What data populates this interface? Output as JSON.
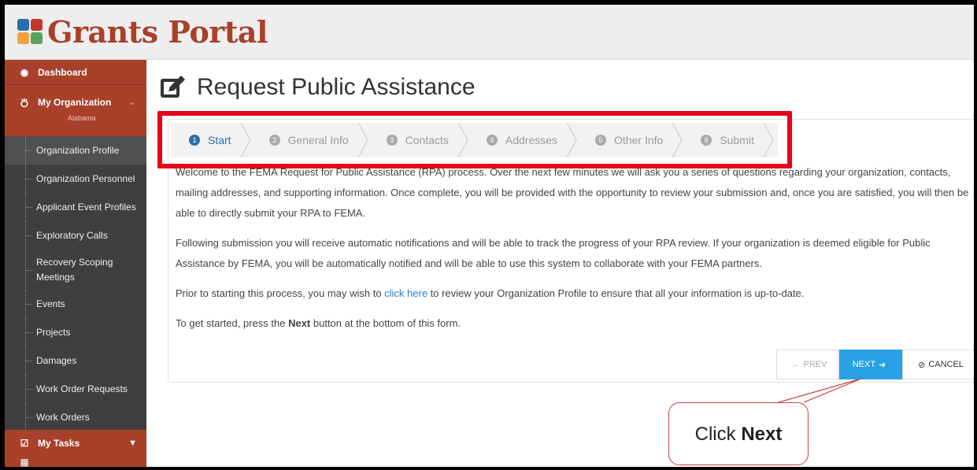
{
  "app": {
    "title": "Grants Portal"
  },
  "sidebar": {
    "dashboard": "Dashboard",
    "org": "My Organization",
    "org_sub": "Alabama",
    "items": [
      {
        "label": "Organization Profile"
      },
      {
        "label": "Organization Personnel"
      },
      {
        "label": "Applicant Event Profiles"
      },
      {
        "label": "Exploratory Calls"
      },
      {
        "label": "Recovery Scoping Meetings"
      },
      {
        "label": "Events"
      },
      {
        "label": "Projects"
      },
      {
        "label": "Damages"
      },
      {
        "label": "Work Order Requests"
      },
      {
        "label": "Work Orders"
      }
    ],
    "tasks": "My Tasks",
    "icons": {
      "dashboard": "dashboard-icon",
      "org": "institution-icon",
      "tasks": "checkbox-icon",
      "calendar": "calendar-icon"
    }
  },
  "page": {
    "title": "Request Public Assistance",
    "title_icon": "edit-icon"
  },
  "steps": [
    {
      "num": "1",
      "label": "Start"
    },
    {
      "num": "2",
      "label": "General Info"
    },
    {
      "num": "3",
      "label": "Contacts"
    },
    {
      "num": "4",
      "label": "Addresses"
    },
    {
      "num": "5",
      "label": "Other Info"
    },
    {
      "num": "6",
      "label": "Submit"
    }
  ],
  "content": {
    "p1": "Welcome to the FEMA Request for Public Assistance (RPA) process. Over the next few minutes we will ask you a series of questions regarding your organization, contacts, mailing addresses, and supporting information. Once complete, you will be provided with the opportunity to review your submission and, once you are satisfied, you will then be able to directly submit your RPA to FEMA.",
    "p2": "Following submission you will receive automatic notifications and will be able to track the progress of your RPA review. If your organization is deemed eligible for Public Assistance by FEMA, you will be automatically notified and will be able to use this system to collaborate with your FEMA partners.",
    "p3_before": "Prior to starting this process, you may wish to ",
    "p3_link": "click here",
    "p3_after": " to review your Organization Profile to ensure that all your information is up-to-date.",
    "p4_before": "To get started, press the ",
    "p4_bold": "Next",
    "p4_after": " button at the bottom of this form."
  },
  "buttons": {
    "prev": "PREV",
    "next": "NEXT",
    "cancel": "CANCEL"
  },
  "callout": {
    "text_before": "Click ",
    "text_bold": "Next"
  },
  "colors": {
    "brand": "#a8402a",
    "accent": "#2d6da8",
    "next_button": "#2aa1e4",
    "highlight": "#e8001b"
  }
}
